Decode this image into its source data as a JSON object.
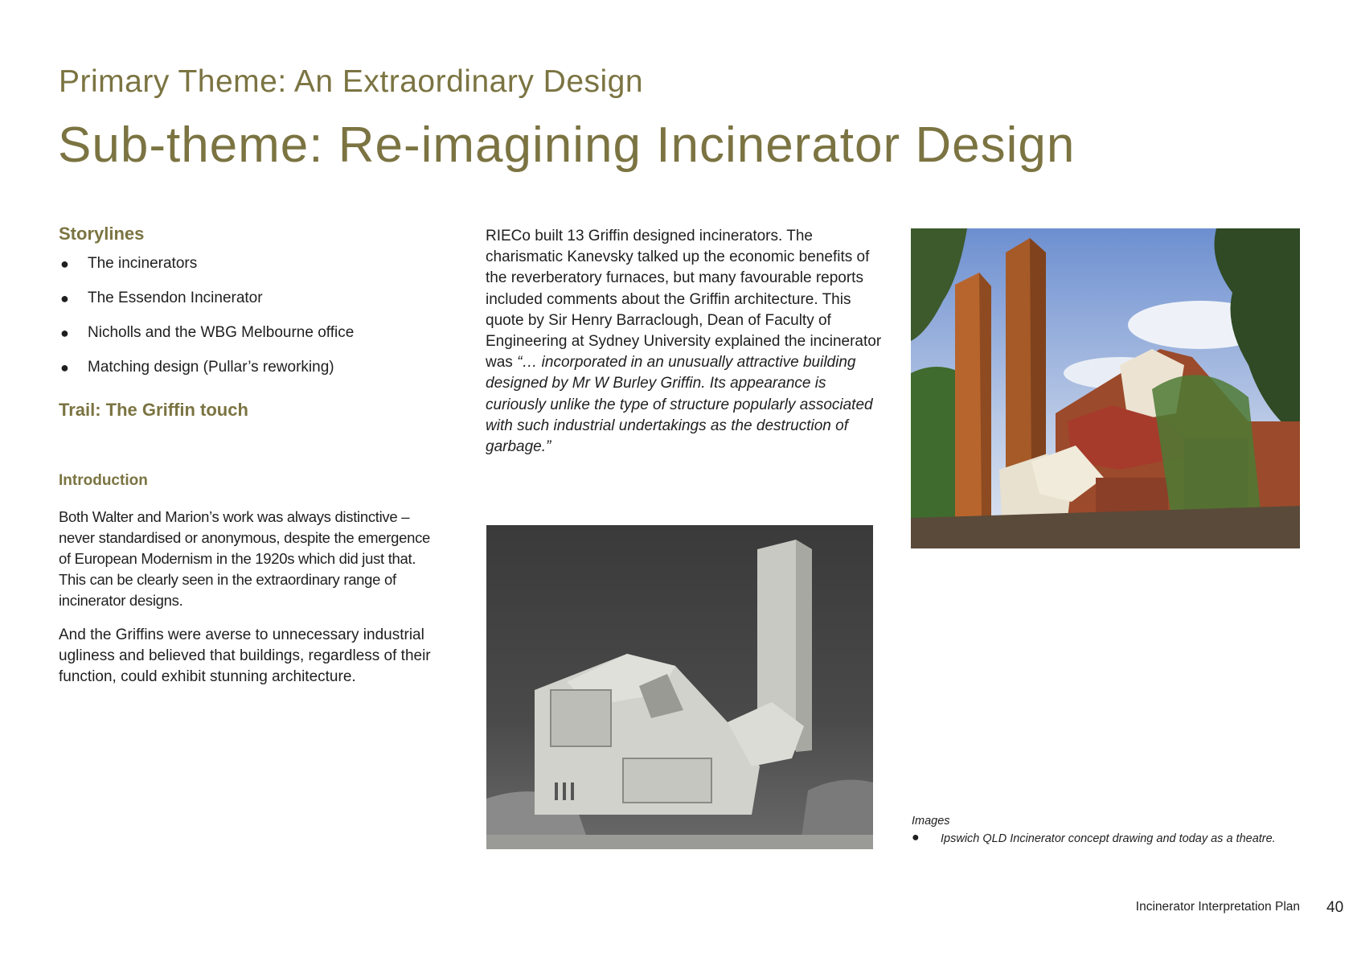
{
  "header": {
    "primary_theme": "Primary Theme: An Extraordinary Design",
    "sub_theme": "Sub-theme: Re-imagining Incinerator Design"
  },
  "left_column": {
    "storylines_heading": "Storylines",
    "storylines": [
      "The incinerators",
      "The Essendon Incinerator",
      "Nicholls and the WBG Melbourne office",
      "Matching design (Pullar’s reworking)"
    ],
    "trail_heading": "Trail: The Griffin touch",
    "introduction_heading": "Introduction",
    "intro_paragraph_1": "Both Walter and Marion’s work was always distinctive – never standardised or anonymous, despite the emergence of European Modernism in the 1920s which did just that. This can be clearly seen in the extraordinary range of incinerator designs.",
    "intro_paragraph_2": "And the Griffins were averse to unnecessary industrial ugliness and believed that buildings, regardless of their function, could exhibit stunning architecture."
  },
  "middle_column": {
    "body_text": "RIECo built 13 Griffin designed incinerators. The charismatic Kanevsky talked up the economic benefits of the reverberatory furnaces, but many favourable reports included comments about the Griffin architecture. This quote by Sir Henry Barraclough, Dean of Faculty of Engineering at Sydney University explained the incinerator was ",
    "quote_text": "“… incorporated in an unusually attractive building designed by Mr W Burley Griffin. Its appearance is curiously unlike the type of structure popularly associated with such industrial undertakings as the destruction of garbage.”"
  },
  "captions": {
    "heading": "Images",
    "items": [
      "Ipswich QLD Incinerator concept drawing and today as a theatre."
    ]
  },
  "footer": {
    "document_title": "Incinerator Interpretation Plan",
    "page_number": "40"
  },
  "colors": {
    "heading_olive": "#7b7442",
    "body_text": "#1f1f1f"
  }
}
